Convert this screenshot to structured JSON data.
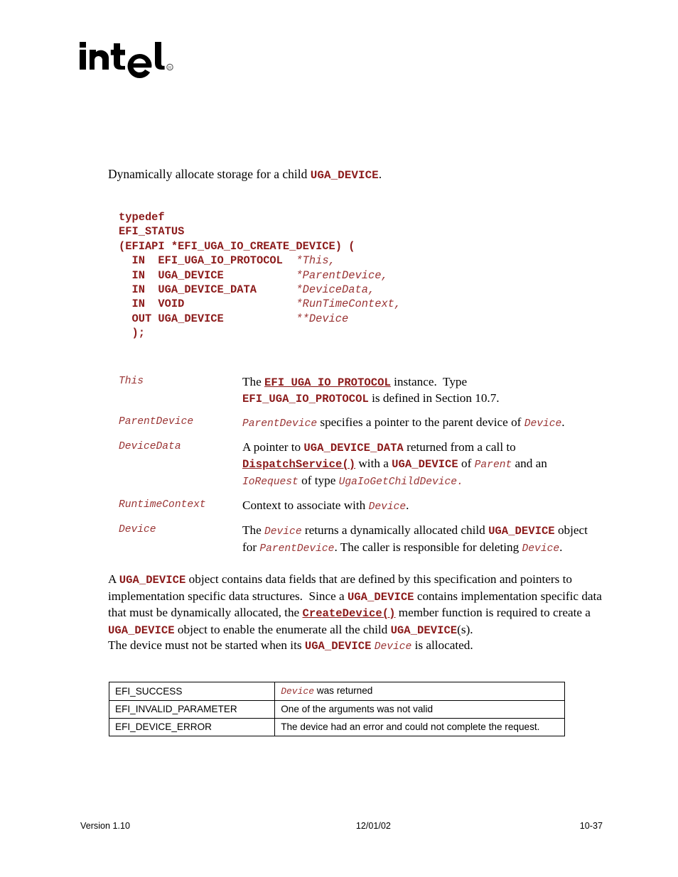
{
  "logo": {
    "name": "intel-logo",
    "wordmark": "intel",
    "registered_mark": "®"
  },
  "intro": {
    "before": "Dynamically allocate storage for a child ",
    "code": "UGA_DEVICE",
    "after": "."
  },
  "code_block": {
    "lines": [
      {
        "segments": [
          {
            "t": "typedef",
            "style": "bold"
          }
        ]
      },
      {
        "segments": [
          {
            "t": "EFI_STATUS",
            "style": "bold"
          }
        ]
      },
      {
        "segments": [
          {
            "t": "(EFIAPI *EFI_UGA_IO_CREATE_DEVICE) (",
            "style": "bold"
          }
        ]
      },
      {
        "segments": [
          {
            "t": "  IN  EFI_UGA_IO_PROTOCOL  ",
            "style": "bold"
          },
          {
            "t": "*This,",
            "style": "italic"
          }
        ]
      },
      {
        "segments": [
          {
            "t": "  IN  UGA_DEVICE           ",
            "style": "bold"
          },
          {
            "t": "*ParentDevice,",
            "style": "italic"
          }
        ]
      },
      {
        "segments": [
          {
            "t": "  IN  UGA_DEVICE_DATA      ",
            "style": "bold"
          },
          {
            "t": "*DeviceData,",
            "style": "italic"
          }
        ]
      },
      {
        "segments": [
          {
            "t": "  IN  VOID                 ",
            "style": "bold"
          },
          {
            "t": "*RunTimeContext,",
            "style": "italic"
          }
        ]
      },
      {
        "segments": [
          {
            "t": "  OUT UGA_DEVICE           ",
            "style": "bold"
          },
          {
            "t": "**Device",
            "style": "italic"
          }
        ]
      },
      {
        "segments": [
          {
            "t": "  );",
            "style": "bold"
          }
        ]
      }
    ]
  },
  "parameters": [
    {
      "name": "This",
      "description_html": "The <span class=\"code link\" data-name=\"efi-uga-io-protocol-link\" data-interactable=\"true\">EFI_UGA_IO_PROTOCOL</span> instance.&nbsp; Type<br><span class=\"code\" data-name=\"inline-code\" data-interactable=\"false\">EFI_UGA_IO_PROTOCOL</span> is defined in Section 10.7."
    },
    {
      "name": "ParentDevice",
      "description_html": "<span class=\"code-i\" data-name=\"inline-code-italic\" data-interactable=\"false\">ParentDevice</span> specifies a pointer to the parent device of <span class=\"code-i\" data-name=\"inline-code-italic\" data-interactable=\"false\">Device</span>."
    },
    {
      "name": "DeviceData",
      "description_html": "A pointer to <span class=\"code\" data-name=\"inline-code\" data-interactable=\"false\">UGA_DEVICE_DATA</span> returned from a call to<br><span class=\"code link\" data-name=\"dispatch-service-link\" data-interactable=\"true\">DispatchService()</span> with a <span class=\"code\" data-name=\"inline-code\" data-interactable=\"false\">UGA_DEVICE</span> of <span class=\"code-i\" data-name=\"inline-code-italic\" data-interactable=\"false\">Parent</span> and an<br><span class=\"code-i\" data-name=\"inline-code-italic\" data-interactable=\"false\">IoRequest</span> of type <span class=\"code-i\" data-name=\"inline-code-italic\" data-interactable=\"false\">UgaIoGetChildDevice.</span>"
    },
    {
      "name": "RuntimeContext",
      "description_html": "Context to associate with <span class=\"code-i\" data-name=\"inline-code-italic\" data-interactable=\"false\">Device</span>."
    },
    {
      "name": "Device",
      "description_html": "The <span class=\"code-i\" data-name=\"inline-code-italic\" data-interactable=\"false\">Device</span> returns a dynamically allocated child <span class=\"code\" data-name=\"inline-code\" data-interactable=\"false\">UGA_DEVICE</span> object<br>for <span class=\"code-i\" data-name=\"inline-code-italic\" data-interactable=\"false\">ParentDevice</span>. The caller is responsible for deleting <span class=\"code-i\" data-name=\"inline-code-italic\" data-interactable=\"false\">Device</span>."
    }
  ],
  "paragraphs": [
    {
      "id": "description-paragraph",
      "html": "A <span class=\"code\" data-name=\"inline-code\" data-interactable=\"false\">UGA_DEVICE</span> object contains data fields that are defined by this specification and pointers to implementation specific data structures.&nbsp; Since a <span class=\"code\" data-name=\"inline-code\" data-interactable=\"false\">UGA_DEVICE</span> contains implementation specific data that must be dynamically allocated, the <span class=\"code link\" data-name=\"create-device-link\" data-interactable=\"true\">CreateDevice()</span> member function is required to create a <span class=\"code\" data-name=\"inline-code\" data-interactable=\"false\">UGA_DEVICE</span> object to enable the enumerate all the child <span class=\"code\" data-name=\"inline-code\" data-interactable=\"false\">UGA_DEVICE</span>(s)."
    },
    {
      "id": "note-paragraph",
      "html": "The device must not be started when its <span class=\"code\" data-name=\"inline-code\" data-interactable=\"false\">UGA_DEVICE</span> <span class=\"code-i\" data-name=\"inline-code-italic\" data-interactable=\"false\">Device</span> is allocated."
    }
  ],
  "status_table": {
    "rows": [
      {
        "code": "EFI_SUCCESS",
        "description_html": "<span class=\"code-i\" data-name=\"inline-code-italic\" data-interactable=\"false\">Device</span> was returned"
      },
      {
        "code": "EFI_INVALID_PARAMETER",
        "description_html": "One of the arguments was not valid"
      },
      {
        "code": "EFI_DEVICE_ERROR",
        "description_html": "The device had an error and could not complete the request."
      }
    ]
  },
  "footer": {
    "version": "Version 1.10",
    "date": "12/01/02",
    "page_number": "10-37"
  },
  "colors": {
    "code_red": "#8B1A1A",
    "code_red_italic": "#993333",
    "text_black": "#000000",
    "page_background": "#ffffff"
  }
}
